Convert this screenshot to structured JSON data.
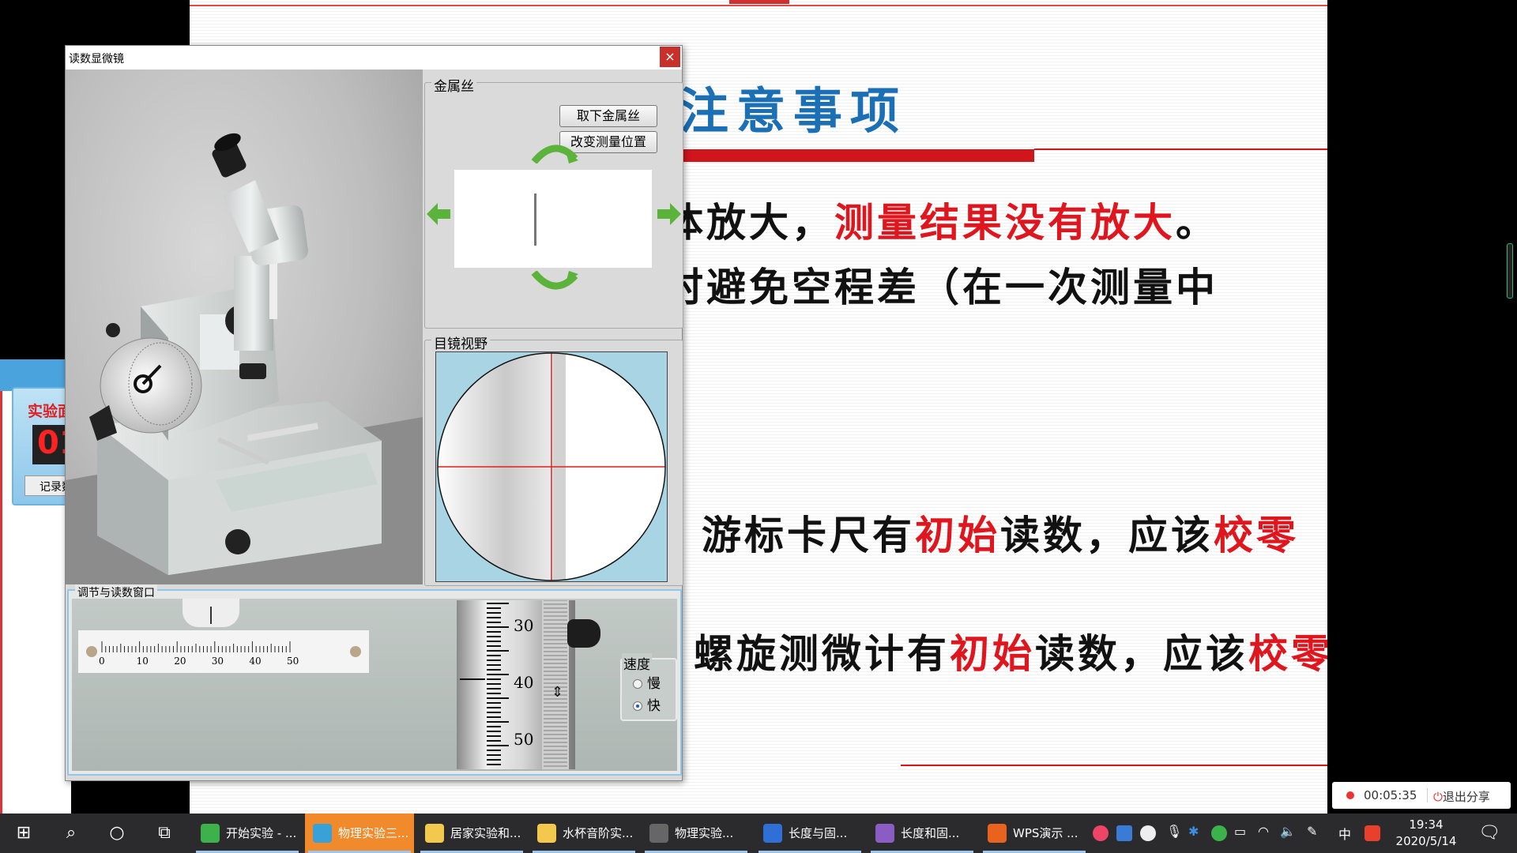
{
  "slide": {
    "title": "注意事项",
    "line1_a": "体放大，",
    "line1_b": "测量结果没有放大",
    "line1_c": "。",
    "line2": "时避免空程差（在一次测量中",
    "line3_a": "游标卡尺有",
    "line3_b": "初始",
    "line3_c": "读数，应该",
    "line3_d": "校零",
    "line4_a": "螺旋测微计有",
    "line4_b": "初始",
    "line4_c": "读数，应该",
    "line4_d": "校零"
  },
  "left_widget": {
    "title": "实验面",
    "digit": "01",
    "button": "记录数"
  },
  "dialog": {
    "title": "读数显微镜",
    "close": "×",
    "wire_group": {
      "label": "金属丝",
      "remove_button": "取下金属丝",
      "change_button": "改变测量位置"
    },
    "eyepiece_group": {
      "label": "目镜视野"
    },
    "adjust_group": {
      "label": "调节与读数窗口",
      "ruler_ticks": [
        "0",
        "10",
        "20",
        "30",
        "40",
        "50"
      ],
      "drum_ticks": [
        "30",
        "40",
        "50"
      ],
      "speed": {
        "label": "速度",
        "options": [
          {
            "label": "慢",
            "selected": false
          },
          {
            "label": "快",
            "selected": true
          }
        ]
      }
    }
  },
  "share": {
    "time": "00:05:35",
    "exit": "退出分享"
  },
  "taskbar": {
    "apps": [
      {
        "label": "开始实验 - ...",
        "color": "#3db14a",
        "active": false
      },
      {
        "label": "物理实验三...",
        "color": "#3aa0d8",
        "active": true
      },
      {
        "label": "居家实验和...",
        "color": "#f2c94c",
        "active": false
      },
      {
        "label": "水杯音阶实...",
        "color": "#f2c94c",
        "active": false
      },
      {
        "label": "物理实验...",
        "color": "#666666",
        "active": false
      },
      {
        "label": "长度与固...",
        "color": "#2f6fd6",
        "active": false
      },
      {
        "label": "长度和固...",
        "color": "#8b5cc4",
        "active": false
      },
      {
        "label": "WPS演示 ...",
        "color": "#e8641e",
        "active": false
      }
    ],
    "tray": {
      "ime": "中"
    },
    "clock": {
      "time": "19:34",
      "date": "2020/5/14"
    }
  },
  "colors": {
    "accent_red": "#e0161e",
    "title_blue": "#1a6fb5",
    "taskbar": "#2b2b2e"
  }
}
